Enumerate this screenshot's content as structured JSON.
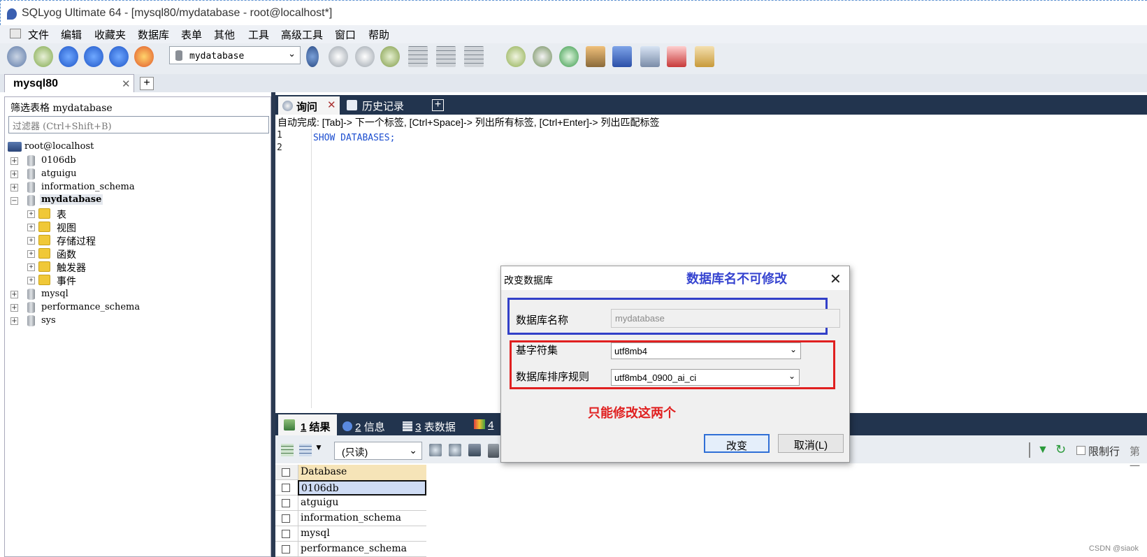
{
  "window": {
    "title": "SQLyog Ultimate 64 - [mysql80/mydatabase - root@localhost*]"
  },
  "menu": [
    "文件",
    "编辑",
    "收藏夹",
    "数据库",
    "表单",
    "其他",
    "工具",
    "高级工具",
    "窗口",
    "帮助"
  ],
  "toolbar": {
    "database_select": "mydatabase"
  },
  "connection_tab": {
    "label": "mysql80",
    "add": "+"
  },
  "object_browser": {
    "filter_label": "筛选表格 mydatabase",
    "filter_placeholder": "过滤器 (Ctrl+Shift+B)",
    "root": "root@localhost",
    "databases": [
      "0106db",
      "atguigu",
      "information_schema",
      "mydatabase",
      "mysql",
      "performance_schema",
      "sys"
    ],
    "expanded_db_children": [
      "表",
      "视图",
      "存储过程",
      "函数",
      "触发器",
      "事件"
    ]
  },
  "editor": {
    "tabs": [
      "询问",
      "历史记录"
    ],
    "tab_add": "+",
    "autocomplete_hint": "自动完成: [Tab]-> 下一个标签, [Ctrl+Space]-> 列出所有标签, [Ctrl+Enter]-> 列出匹配标签",
    "line_numbers": [
      "1",
      "2"
    ],
    "sql": "SHOW DATABASES;"
  },
  "results": {
    "tabs": [
      {
        "num": "1",
        "label": "结果"
      },
      {
        "num": "2",
        "label": "信息"
      },
      {
        "num": "3",
        "label": "表数据"
      },
      {
        "num": "4",
        "label": ""
      }
    ],
    "mode_select": "(只读)",
    "limit_label": "限制行",
    "first_label": "第一",
    "column_header": "Database",
    "rows": [
      "0106db",
      "atguigu",
      "information_schema",
      "mysql",
      "performance_schema"
    ]
  },
  "dialog": {
    "title": "改变数据库",
    "annotation_top": "数据库名不可修改",
    "annotation_bottom": "只能修改这两个",
    "name_label": "数据库名称",
    "name_value": "mydatabase",
    "charset_label": "基字符集",
    "charset_value": "utf8mb4",
    "collation_label": "数据库排序规则",
    "collation_value": "utf8mb4_0900_ai_ci",
    "change_button": "改变",
    "cancel_button": "取消(L)"
  },
  "watermark": "CSDN @siaok",
  "colors": {
    "annotation_blue": "#3240c8",
    "annotation_red": "#e02020",
    "dark_panel": "#22344e"
  }
}
